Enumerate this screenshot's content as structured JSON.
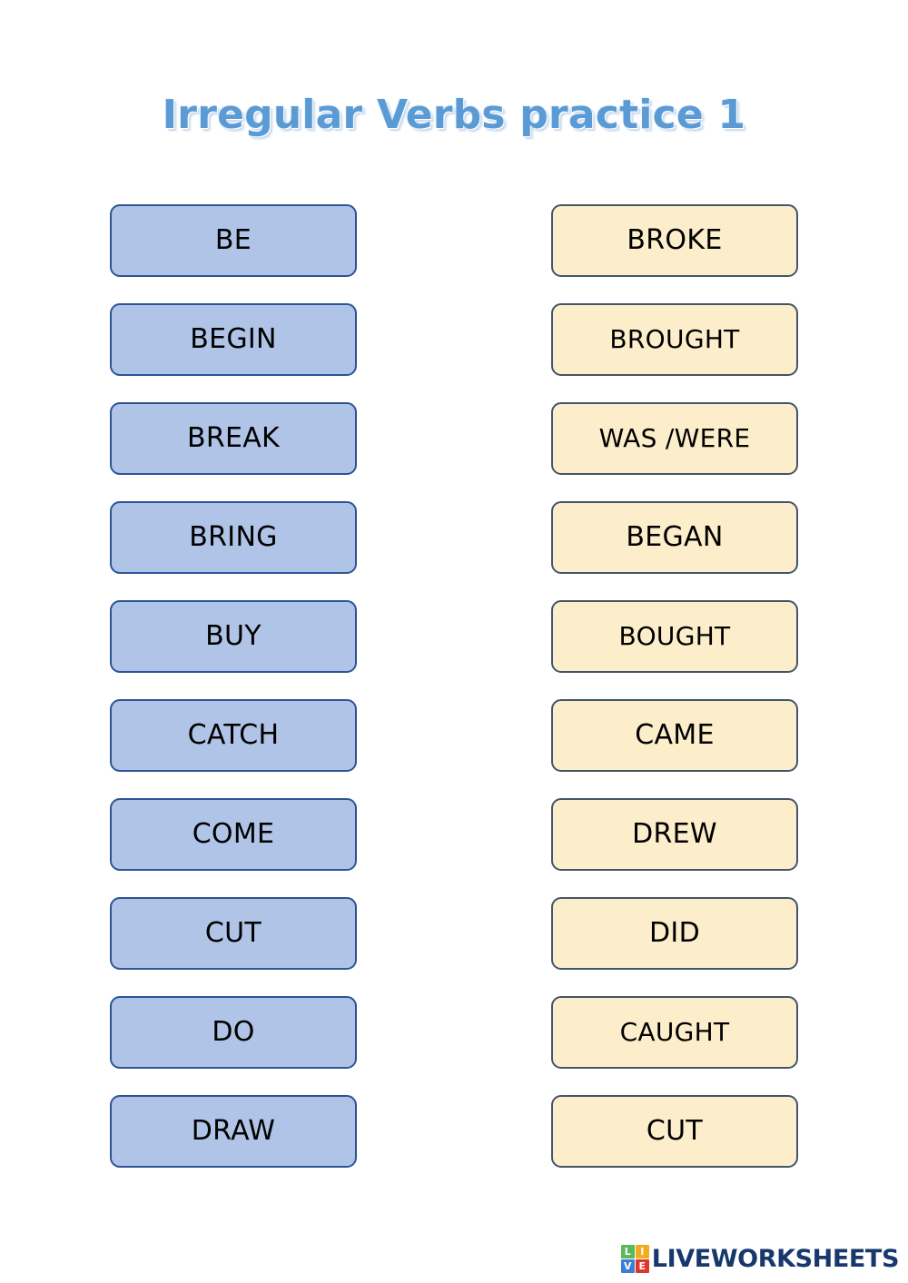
{
  "worksheet": {
    "title": "Irregular Verbs practice 1",
    "columns": {
      "base_forms": {
        "name": "base-form-column",
        "fill_color": "#b0c4e8",
        "border_color": "#2e5496",
        "items": [
          "BE",
          "BEGIN",
          "BREAK",
          "BRING",
          "BUY",
          "CATCH",
          "COME",
          "CUT",
          "DO",
          "DRAW"
        ]
      },
      "past_forms": {
        "name": "past-form-column",
        "fill_color": "#fceecb",
        "border_color": "#44546a",
        "items": [
          "BROKE",
          "BROUGHT",
          "WAS /WERE",
          "BEGAN",
          "BOUGHT",
          "CAME",
          "DREW",
          "DID",
          "CAUGHT",
          "CUT"
        ]
      }
    }
  },
  "footer": {
    "logo": {
      "tiles": [
        "L",
        "I",
        "V",
        "E"
      ],
      "tile_colors": [
        "#5cb85c",
        "#f0ad20",
        "#3a7fd5",
        "#e0332c"
      ],
      "wordmark": "LIVEWORKSHEETS",
      "wordmark_color": "#16386b"
    }
  },
  "theme": {
    "title_color": "#5b9bd5",
    "page_background": "#ffffff",
    "text_color": "#000000"
  }
}
